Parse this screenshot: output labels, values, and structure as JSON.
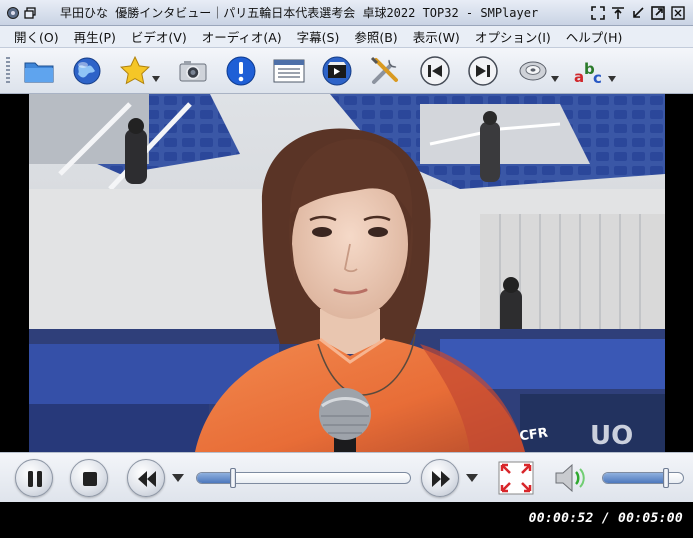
{
  "window": {
    "title": "早田ひな 優勝インタビュー｜パリ五輪日本代表選考会 卓球2022 TOP32 - SMPlayer"
  },
  "menu": {
    "items": [
      "開く(O)",
      "再生(P)",
      "ビデオ(V)",
      "オーディオ(A)",
      "字幕(S)",
      "参照(B)",
      "表示(W)",
      "オプション(I)",
      "ヘルプ(H)"
    ]
  },
  "toolbar": {
    "icons": [
      "open-folder-icon",
      "open-url-icon",
      "favorites-icon",
      "screenshot-icon",
      "info-icon",
      "playlist-icon",
      "video-file-icon",
      "preferences-icon",
      "previous-icon",
      "next-icon",
      "audio-track-icon",
      "subtitles-icon"
    ]
  },
  "playback": {
    "current_time": "00:00:52",
    "total_time": "00:05:00",
    "time_display": "00:00:52 / 00:05:00",
    "progress_fraction": 0.173,
    "volume_fraction": 0.78
  },
  "colors": {
    "accent": "#4d78bd",
    "titlebar": "#c9d3e4",
    "menubar": "#e9eef6"
  }
}
